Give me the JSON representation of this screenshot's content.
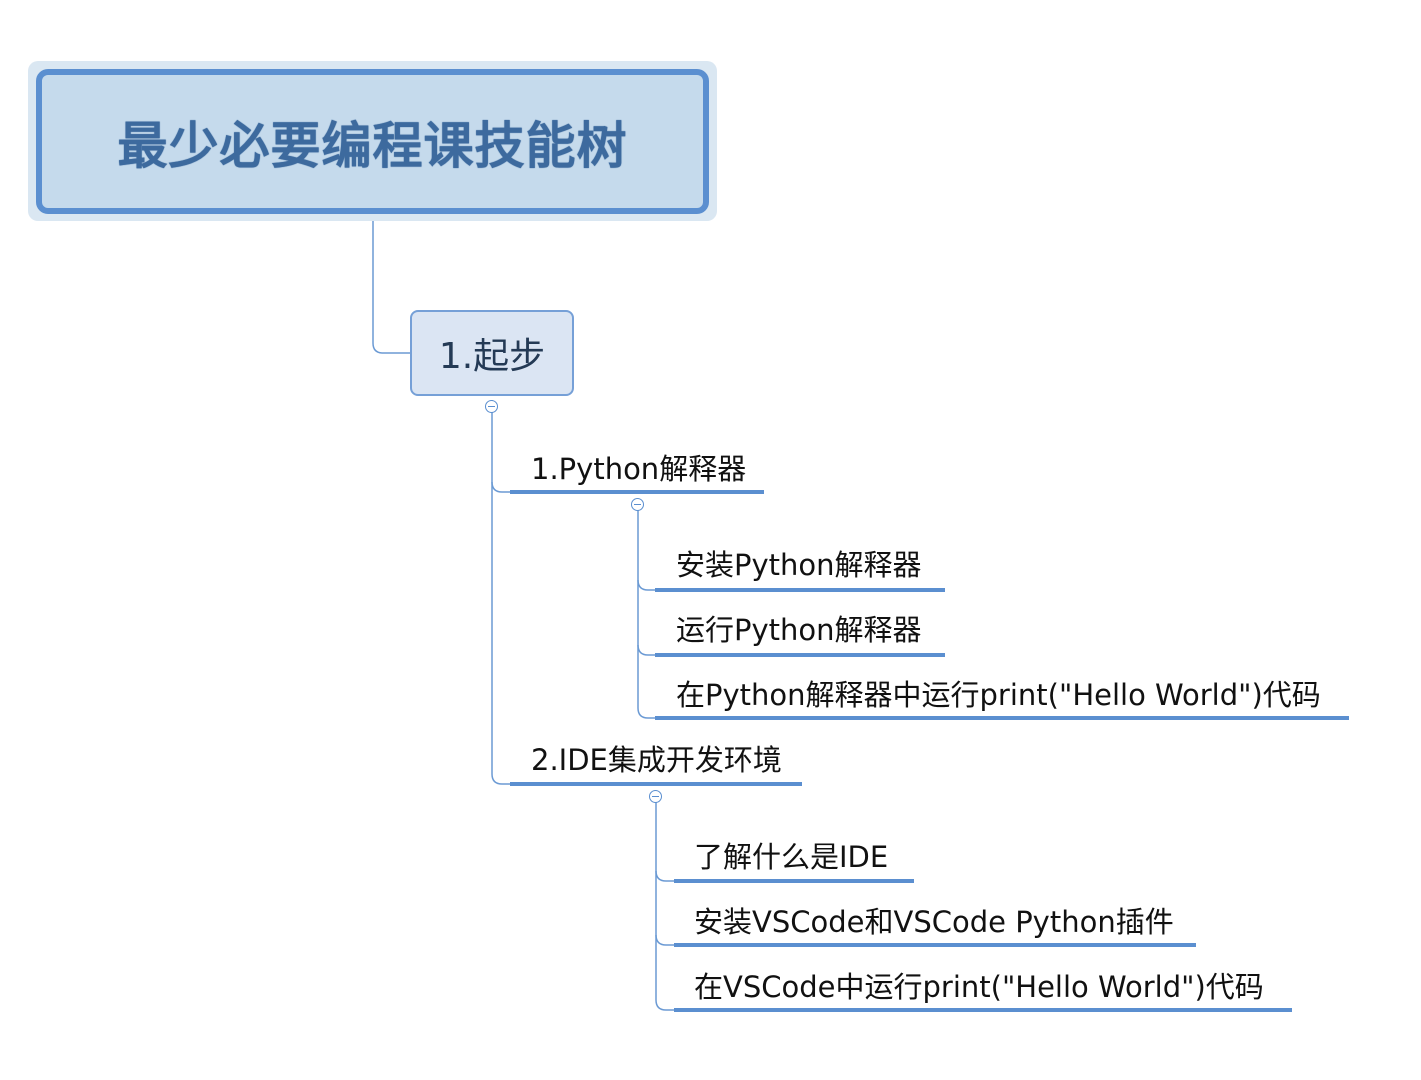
{
  "root": {
    "title": "最少必要编程课技能树"
  },
  "main_topic": {
    "label": "1.起步"
  },
  "subtopics": [
    {
      "label": "1.Python解释器",
      "children": [
        "安装Python解释器",
        "运行Python解释器",
        "在Python解释器中运行print(\"Hello World\")代码"
      ]
    },
    {
      "label": "2.IDE集成开发环境",
      "children": [
        "了解什么是IDE",
        "安装VSCode和VSCode Python插件",
        "在VSCode中运行print(\"Hello World\")代码"
      ]
    }
  ],
  "colors": {
    "line": "#5b8fd0",
    "root_fill": "#c5daec",
    "topic_fill": "#dbe5f3"
  },
  "icons": {
    "collapse": "collapse-minus-icon"
  }
}
